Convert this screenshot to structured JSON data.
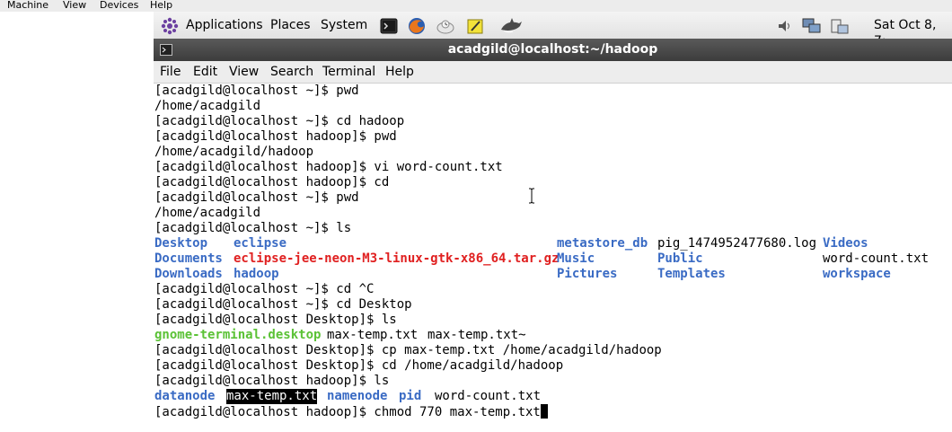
{
  "vm_menu": [
    "Machine",
    "View",
    "Devices",
    "Help"
  ],
  "panel": {
    "applications": "Applications",
    "places": "Places",
    "system": "System",
    "datetime": "Sat Oct  8,  7:"
  },
  "window": {
    "title": "acadgild@localhost:~/hadoop"
  },
  "terminal_menu": [
    "File",
    "Edit",
    "View",
    "Search",
    "Terminal",
    "Help"
  ],
  "lines": [
    "[acadgild@localhost ~]$ pwd",
    "/home/acadgild",
    "[acadgild@localhost ~]$ cd hadoop",
    "[acadgild@localhost hadoop]$ pwd",
    "/home/acadgild/hadoop",
    "[acadgild@localhost hadoop]$ vi word-count.txt",
    "[acadgild@localhost hadoop]$ cd",
    "[acadgild@localhost ~]$ pwd",
    "/home/acadgild",
    "[acadgild@localhost ~]$ ls"
  ],
  "ls_home": {
    "row1": [
      "Desktop",
      "eclipse",
      "metastore_db",
      "pig_1474952477680.log",
      "Videos"
    ],
    "row2": [
      "Documents",
      "eclipse-jee-neon-M3-linux-gtk-x86_64.tar.gz",
      "Music",
      "Public",
      "word-count.txt"
    ],
    "row3": [
      "Downloads",
      "hadoop",
      "Pictures",
      "Templates",
      "workspace"
    ]
  },
  "lines2": [
    "[acadgild@localhost ~]$ cd ^C",
    "[acadgild@localhost ~]$ cd Desktop",
    "[acadgild@localhost Desktop]$ ls"
  ],
  "ls_desktop": [
    "gnome-terminal.desktop",
    "max-temp.txt",
    "max-temp.txt~"
  ],
  "lines3": [
    "[acadgild@localhost Desktop]$ cp max-temp.txt /home/acadgild/hadoop",
    "[acadgild@localhost Desktop]$ cd /home/acadgild/hadoop",
    "[acadgild@localhost hadoop]$ ls"
  ],
  "ls_hadoop": [
    "datanode",
    "max-temp.txt",
    "namenode",
    "pid",
    "word-count.txt"
  ],
  "current_command": "[acadgild@localhost hadoop]$ chmod 770 max-temp.txt"
}
